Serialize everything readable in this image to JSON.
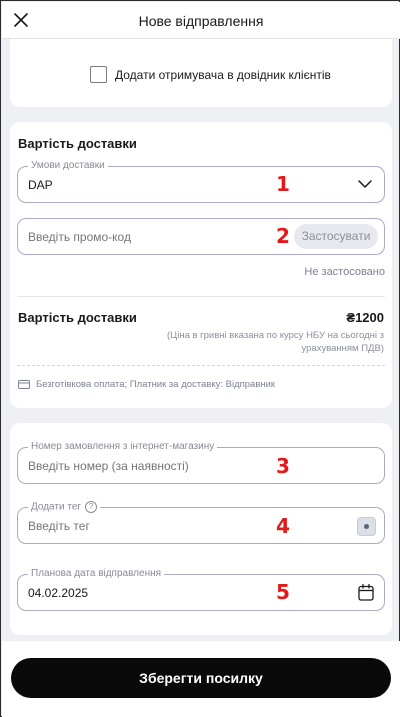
{
  "header": {
    "title": "Нове відправлення",
    "close_icon": "close-icon"
  },
  "recipient": {
    "add_to_directory_label": "Додати отримувача в довідник клієнтів",
    "checked": false
  },
  "delivery_cost": {
    "section_title": "Вартість доставки",
    "terms": {
      "legend": "Умови доставки",
      "value": "DAP",
      "marker": "1"
    },
    "promo": {
      "placeholder": "Введіть промо-код",
      "apply_label": "Застосувати",
      "status": "Не застосовано",
      "marker": "2"
    },
    "total": {
      "label": "Вартість доставки",
      "value": "₴1200",
      "note": "(Ціна в гривні вказана по курсу НБУ на сьогодні з урахуванням ПДВ)"
    },
    "payment_info": "Безготівкова оплата; Платник за доставку: Відправник"
  },
  "extra": {
    "order_number": {
      "legend": "Номер замовлення з інтернет-магазину",
      "placeholder": "Введіть номер (за наявності)",
      "marker": "3"
    },
    "tag": {
      "legend": "Додати тег",
      "placeholder": "Введіть тег",
      "help_symbol": "?",
      "marker": "4"
    },
    "ship_date": {
      "legend": "Планова дата відправлення",
      "value": "04.02.2025",
      "marker": "5"
    }
  },
  "footer": {
    "save_label": "Зберегти посилку"
  },
  "colors": {
    "background": "#eff0f4",
    "marker_red": "#e21a1a",
    "primary_button": "#0a0a0a",
    "field_border": "#a9acc4"
  }
}
